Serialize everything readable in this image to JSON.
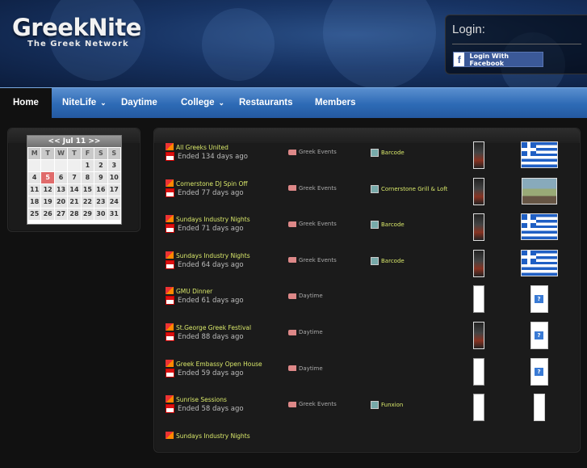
{
  "header": {
    "logo": "GreekNite",
    "tagline": "The Greek Network",
    "login_title": "Login:",
    "facebook_button": "Login With Facebook"
  },
  "nav": {
    "items": [
      {
        "label": "Home",
        "active": true
      },
      {
        "label": "NiteLife",
        "dropdown": true
      },
      {
        "label": "Daytime"
      },
      {
        "label": "College",
        "dropdown": true
      },
      {
        "label": "Restaurants"
      },
      {
        "label": "Members"
      }
    ]
  },
  "calendar": {
    "title": "<< Jul 11 >>",
    "dow": [
      "M",
      "T",
      "W",
      "T",
      "F",
      "S",
      "S"
    ],
    "today": "5",
    "weeks": [
      [
        "",
        "",
        "",
        "",
        "",
        "1",
        "2",
        "3"
      ],
      [
        "4",
        "5",
        "6",
        "7",
        "8",
        "9",
        "10"
      ],
      [
        "11",
        "12",
        "13",
        "14",
        "15",
        "16",
        "17"
      ],
      [
        "18",
        "19",
        "20",
        "21",
        "22",
        "23",
        "24"
      ],
      [
        "25",
        "26",
        "27",
        "28",
        "29",
        "30",
        "31"
      ]
    ]
  },
  "events": [
    {
      "title": "All Greeks United",
      "status": "Ended 134 days ago",
      "category": "Greek Events",
      "venue": "Barcode",
      "flyer": "dark",
      "thumb": "flag"
    },
    {
      "title": "Cornerstone DJ Spin Off",
      "status": "Ended 77 days ago",
      "category": "Greek Events",
      "venue": "Cornerstone Grill & Loft",
      "flyer": "dark",
      "thumb": "photo"
    },
    {
      "title": "Sundays Industry Nights",
      "status": "Ended 71 days ago",
      "category": "Greek Events",
      "venue": "Barcode",
      "flyer": "dark",
      "thumb": "flag"
    },
    {
      "title": "Sundays Industry Nights",
      "status": "Ended 64 days ago",
      "category": "Greek Events",
      "venue": "Barcode",
      "flyer": "dark",
      "thumb": "flag"
    },
    {
      "title": "GMU Dinner",
      "status": "Ended 61 days ago",
      "category": "Daytime",
      "venue": "",
      "flyer": "blank",
      "thumb": "q"
    },
    {
      "title": "St.George Greek Festival",
      "status": "Ended 88 days ago",
      "category": "Daytime",
      "venue": "",
      "flyer": "dark",
      "thumb": "q"
    },
    {
      "title": "Greek Embassy Open House",
      "status": "Ended 59 days ago",
      "category": "Daytime",
      "venue": "",
      "flyer": "blank",
      "thumb": "q"
    },
    {
      "title": "Sunrise Sessions",
      "status": "Ended 58 days ago",
      "category": "Greek Events",
      "venue": "Funxion",
      "flyer": "blank",
      "thumb": "blank"
    },
    {
      "title": "Sundays Industry Nights",
      "status": "",
      "category": "",
      "venue": "",
      "flyer": "",
      "thumb": ""
    }
  ]
}
